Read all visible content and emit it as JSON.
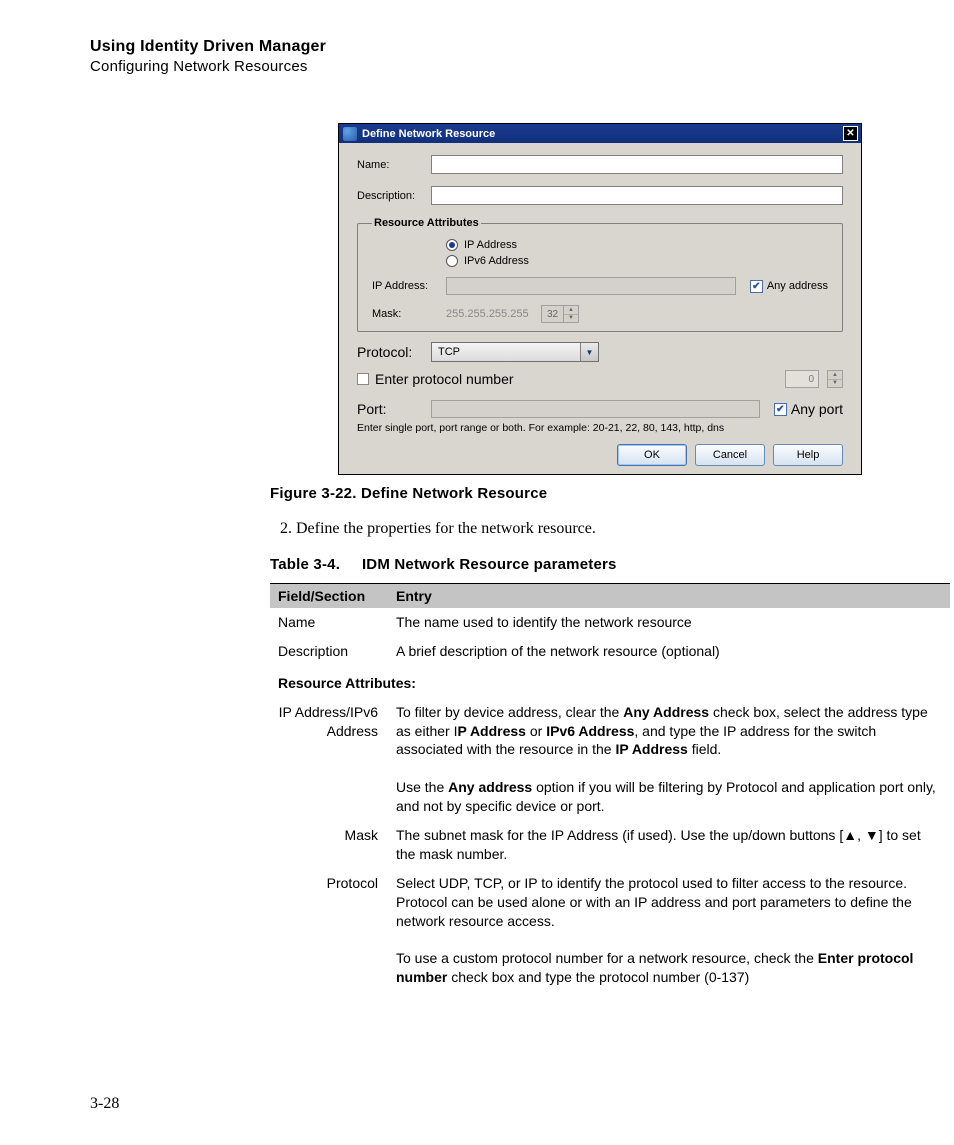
{
  "header": {
    "title": "Using Identity Driven Manager",
    "subtitle": "Configuring Network Resources"
  },
  "dialog": {
    "title": "Define Network Resource",
    "name_label": "Name:",
    "desc_label": "Description:",
    "attrs_legend": "Resource Attributes",
    "radio_ip": "IP Address",
    "radio_ipv6": "IPv6 Address",
    "ipaddr_label": "IP Address:",
    "any_address": "Any address",
    "mask_label": "Mask:",
    "mask_value": "255.255.255.255",
    "mask_num": "32",
    "protocol_label": "Protocol:",
    "protocol_value": "TCP",
    "enter_proto": "Enter protocol number",
    "proto_num": "0",
    "port_label": "Port:",
    "any_port": "Any port",
    "hint": "Enter single port, port range or both.  For example: 20-21, 22, 80, 143, http, dns",
    "buttons": {
      "ok": "OK",
      "cancel": "Cancel",
      "help": "Help"
    }
  },
  "figure_caption": "Figure 3-22. Define Network Resource",
  "step": "2.   Define the properties for the network resource.",
  "table_caption_prefix": "Table 3-4.",
  "table_caption_title": "IDM Network Resource parameters",
  "table": {
    "head1": "Field/Section",
    "head2": "Entry",
    "rows": {
      "name_f": "Name",
      "name_e": "The name used to identify the network resource",
      "desc_f": "Description",
      "desc_e": "A brief description of the network resource (optional)",
      "subhead": "Resource Attributes:",
      "ip_f1": "IP Address/IPv6",
      "ip_f2": "Address",
      "ip_e1a": "To filter by device address, clear the ",
      "ip_e1b": "Any Address",
      "ip_e1c": " check box, select the address type as either I",
      "ip_e1d": "P Address",
      "ip_e1e": " or ",
      "ip_e1f": "IPv6 Address",
      "ip_e1g": ", and type the IP address for the switch associated with the resource in the ",
      "ip_e1h": "IP Address",
      "ip_e1i": " field.",
      "ip_e2a": "Use the ",
      "ip_e2b": "Any address",
      "ip_e2c": " option if you will be filtering by Protocol and application port only, and not by specific device or port.",
      "mask_f": "Mask",
      "mask_e": "The subnet mask for the IP Address (if used). Use the up/down buttons [▲, ▼] to set the mask number.",
      "proto_f": "Protocol",
      "proto_e1": "Select UDP, TCP, or IP to identify the protocol used to filter access to the resource. Protocol can be used alone or with an IP address and port parameters to define the network resource access.",
      "proto_e2a": "To use a custom protocol number for a network resource, check the ",
      "proto_e2b": "Enter protocol number",
      "proto_e2c": " check box and type the protocol number (0-137)"
    }
  },
  "page_num": "3-28"
}
